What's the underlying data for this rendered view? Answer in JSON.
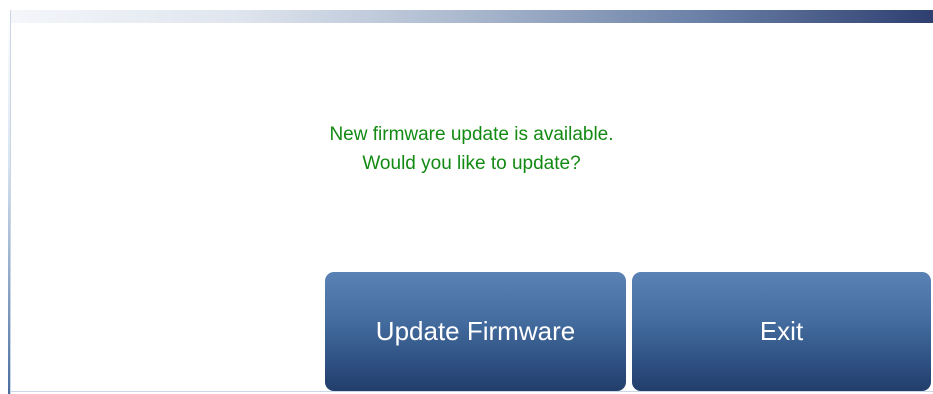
{
  "dialog": {
    "message_line1": "New firmware update is available.",
    "message_line2": "Would you like to update?"
  },
  "buttons": {
    "update_label": "Update Firmware",
    "exit_label": "Exit"
  },
  "colors": {
    "message_text": "#128a12",
    "button_top": "#5a82b4",
    "button_bottom": "#223e6b",
    "header_gradient_end": "#2e3f70"
  }
}
